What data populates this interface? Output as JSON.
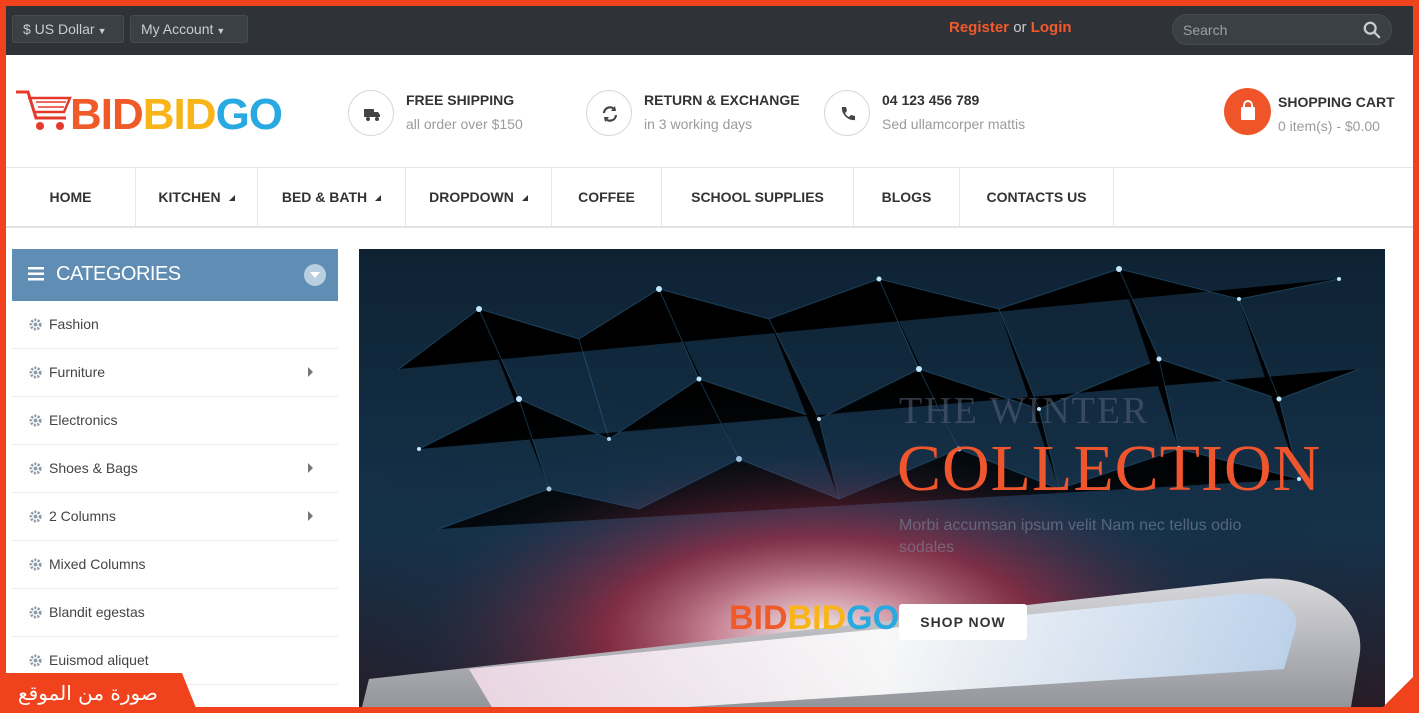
{
  "topbar": {
    "currency": "$ US Dollar",
    "account": "My Account",
    "register": "Register",
    "or": "or",
    "login": "Login",
    "search_placeholder": "Search"
  },
  "header": {
    "logo": {
      "part1": "BID",
      "part2": "BID",
      "part3": "GO"
    },
    "features": [
      {
        "icon": "truck-icon",
        "title": "FREE SHIPPING",
        "subtitle": "all order over $150"
      },
      {
        "icon": "refresh-icon",
        "title": "RETURN & EXCHANGE",
        "subtitle": "in 3 working days"
      },
      {
        "icon": "phone-icon",
        "title": "04 123 456 789",
        "subtitle": "Sed ullamcorper mattis"
      }
    ],
    "cart": {
      "title": "SHOPPING CART",
      "summary": "0 item(s) - $0.00"
    }
  },
  "nav": {
    "items": [
      {
        "label": "HOME"
      },
      {
        "label": "KITCHEN"
      },
      {
        "label": "BED & BATH"
      },
      {
        "label": "DROPDOWN"
      },
      {
        "label": "COFFEE"
      },
      {
        "label": "SCHOOL SUPPLIES"
      },
      {
        "label": "BLOGS"
      },
      {
        "label": "CONTACTS US"
      }
    ]
  },
  "sidebar": {
    "title": "CATEGORIES",
    "items": [
      {
        "label": "Fashion"
      },
      {
        "label": "Furniture"
      },
      {
        "label": "Electronics"
      },
      {
        "label": "Shoes & Bags"
      },
      {
        "label": "2 Columns"
      },
      {
        "label": "Mixed Columns"
      },
      {
        "label": "Blandit egestas"
      },
      {
        "label": "Euismod aliquet"
      }
    ]
  },
  "banner": {
    "kicker": "THE WINTER",
    "title": "COLLECTION",
    "text": "Morbi accumsan ipsum velit Nam nec tellus odio sodales",
    "button": "SHOP NOW",
    "logo": {
      "part1": "BID",
      "part2": "BID",
      "part3": "GO"
    }
  },
  "watermark": "صورة من الموقع",
  "colors": {
    "accent": "#f0421c",
    "topbar": "#2f3338",
    "category_header": "#5f8db3",
    "title": "#f0562e"
  }
}
